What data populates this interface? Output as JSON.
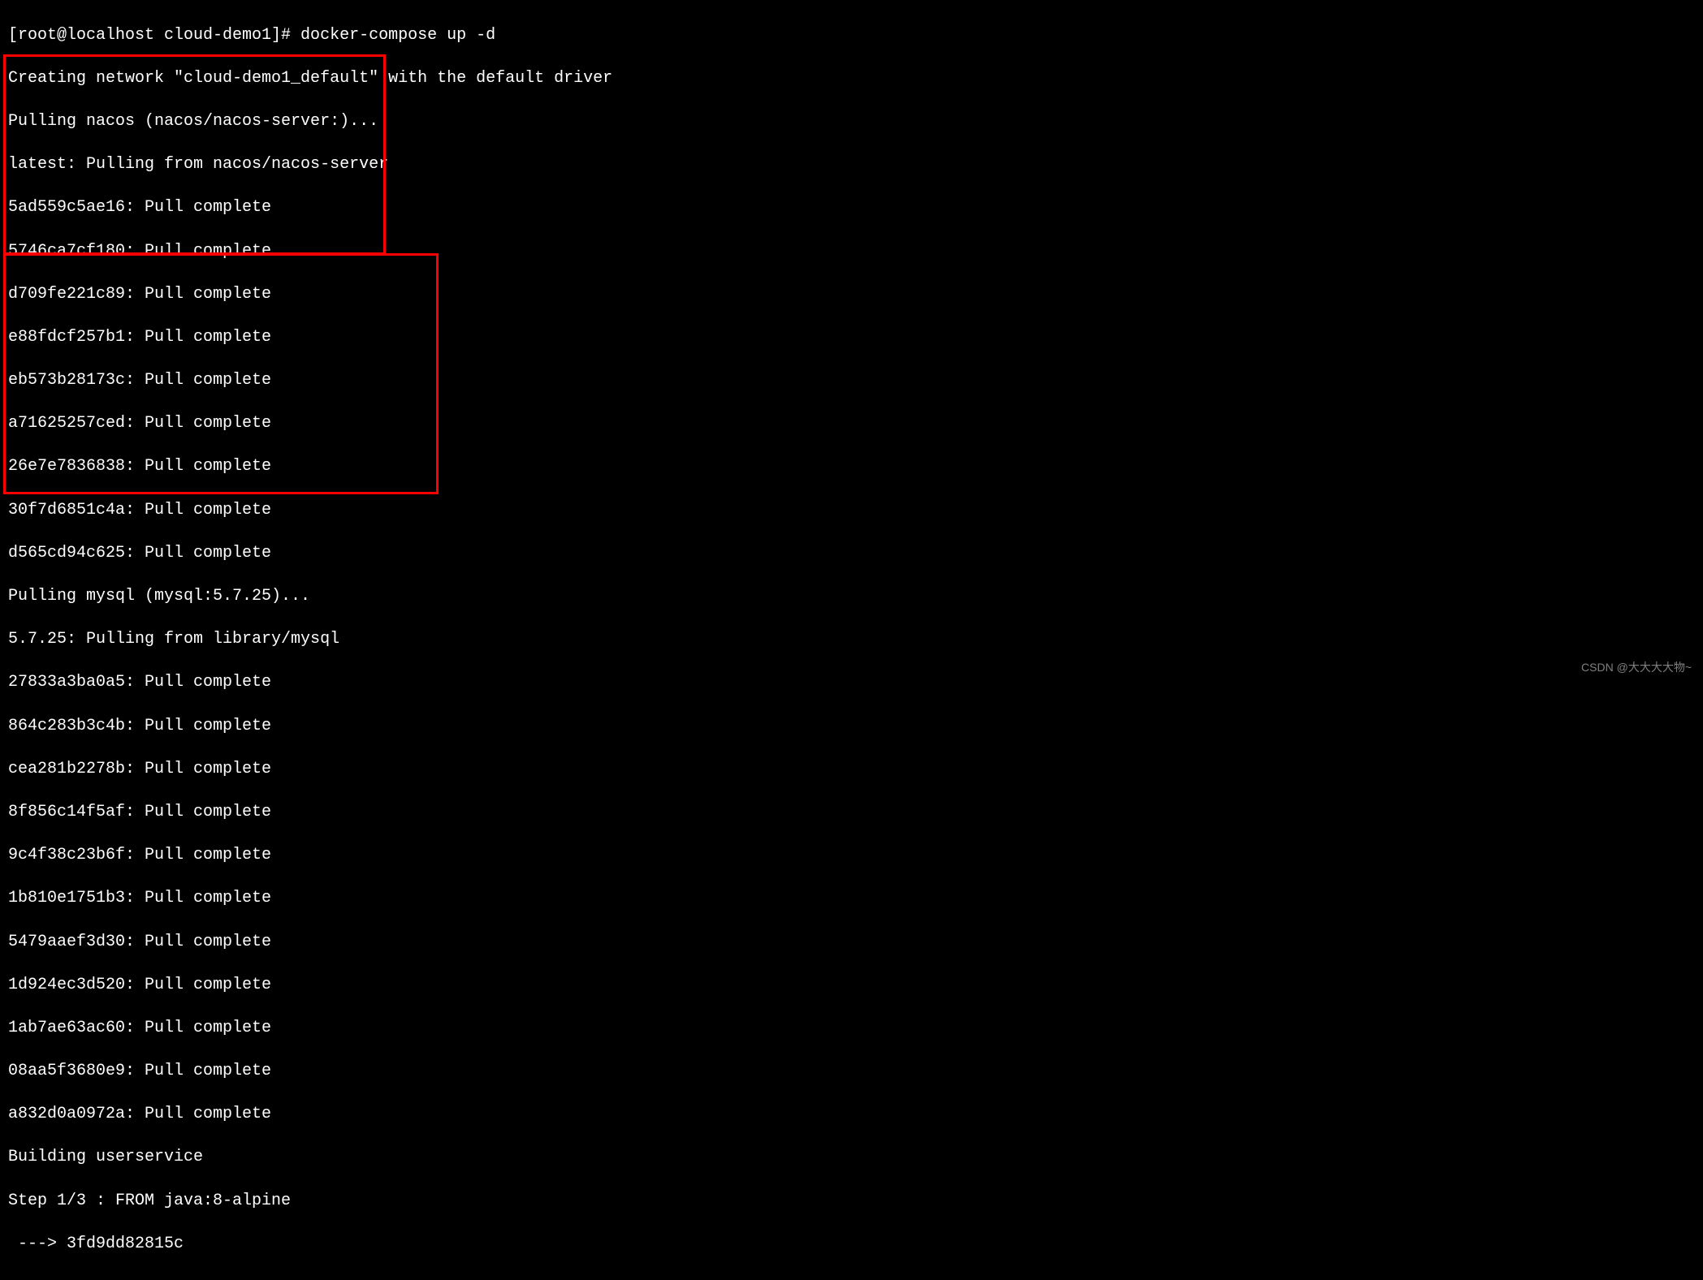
{
  "terminal": {
    "prompt_line": "[root@localhost cloud-demo1]# docker-compose up -d",
    "create_network": "Creating network \"cloud-demo1_default\" with the default driver",
    "pulling_nacos": "Pulling nacos (nacos/nacos-server:)...",
    "nacos_lines": [
      "latest: Pulling from nacos/nacos-server",
      "5ad559c5ae16: Pull complete",
      "5746ca7cf180: Pull complete",
      "d709fe221c89: Pull complete",
      "e88fdcf257b1: Pull complete",
      "eb573b28173c: Pull complete",
      "a71625257ced: Pull complete",
      "26e7e7836838: Pull complete",
      "30f7d6851c4a: Pull complete",
      "d565cd94c625: Pull complete"
    ],
    "pulling_mysql": "Pulling mysql (mysql:5.7.25)...",
    "mysql_lines": [
      "5.7.25: Pulling from library/mysql",
      "27833a3ba0a5: Pull complete",
      "864c283b3c4b: Pull complete",
      "cea281b2278b: Pull complete",
      "8f856c14f5af: Pull complete",
      "9c4f38c23b6f: Pull complete",
      "1b810e1751b3: Pull complete",
      "5479aaef3d30: Pull complete",
      "1d924ec3d520: Pull complete",
      "1ab7ae63ac60: Pull complete",
      "08aa5f3680e9: Pull complete",
      "a832d0a0972a: Pull complete"
    ],
    "building_line": "Building userservice",
    "step_line": "Step 1/3 : FROM java:8-alpine",
    "arrow_line": " ---> 3fd9dd82815c"
  },
  "watermark": "CSDN @大大大大物~"
}
